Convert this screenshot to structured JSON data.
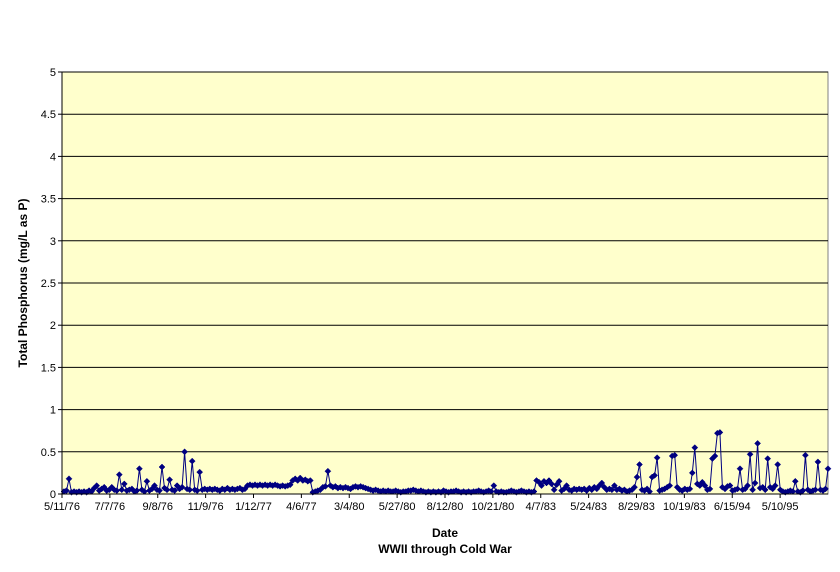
{
  "chart_data": {
    "type": "scatter",
    "line": true,
    "xlabel": "Date",
    "subtitle": "WWII through Cold War",
    "ylabel": "Total Phosphorus (mg/L as P)",
    "ylim": [
      0,
      5
    ],
    "yticks": [
      "0",
      "0.5",
      "1",
      "1.5",
      "2",
      "2.5",
      "3",
      "3.5",
      "4",
      "4.5",
      "5"
    ],
    "x_tick_labels": [
      "5/11/76",
      "7/7/76",
      "9/8/76",
      "11/9/76",
      "1/12/77",
      "4/6/77",
      "3/4/80",
      "5/27/80",
      "8/12/80",
      "10/21/80",
      "4/7/83",
      "5/24/83",
      "8/29/83",
      "10/19/83",
      "6/15/94",
      "5/10/95"
    ],
    "grid": "horizontal",
    "legend": "none",
    "plot_background": "#FFFFCC",
    "marker_color": "#000080",
    "series": [
      {
        "values": [
          0.03,
          0.04,
          0.18,
          0.02,
          0.03,
          0.02,
          0.03,
          0.02,
          0.03,
          0.02,
          0.04,
          0.03,
          0.07,
          0.1,
          0.04,
          0.06,
          0.08,
          0.04,
          0.05,
          0.08,
          0.05,
          0.04,
          0.23,
          0.05,
          0.12,
          0.04,
          0.05,
          0.06,
          0.03,
          0.04,
          0.3,
          0.05,
          0.03,
          0.15,
          0.04,
          0.06,
          0.1,
          0.05,
          0.04,
          0.32,
          0.07,
          0.05,
          0.17,
          0.05,
          0.04,
          0.1,
          0.06,
          0.08,
          0.5,
          0.06,
          0.05,
          0.39,
          0.05,
          0.04,
          0.26,
          0.05,
          0.06,
          0.05,
          0.06,
          0.05,
          0.06,
          0.05,
          0.04,
          0.06,
          0.05,
          0.07,
          0.05,
          0.06,
          0.05,
          0.06,
          0.07,
          0.05,
          0.06,
          0.1,
          0.11,
          0.1,
          0.11,
          0.1,
          0.11,
          0.1,
          0.11,
          0.1,
          0.11,
          0.1,
          0.11,
          0.1,
          0.09,
          0.1,
          0.09,
          0.1,
          0.11,
          0.16,
          0.18,
          0.16,
          0.19,
          0.16,
          0.17,
          0.15,
          0.16,
          0.02,
          0.03,
          0.04,
          0.05,
          0.08,
          0.09,
          0.27,
          0.1,
          0.08,
          0.09,
          0.07,
          0.08,
          0.07,
          0.08,
          0.07,
          0.06,
          0.08,
          0.09,
          0.08,
          0.09,
          0.08,
          0.07,
          0.06,
          0.05,
          0.04,
          0.05,
          0.04,
          0.03,
          0.04,
          0.03,
          0.04,
          0.03,
          0.03,
          0.04,
          0.03,
          0.02,
          0.03,
          0.03,
          0.04,
          0.04,
          0.05,
          0.04,
          0.03,
          0.04,
          0.03,
          0.02,
          0.03,
          0.02,
          0.03,
          0.02,
          0.03,
          0.02,
          0.04,
          0.03,
          0.02,
          0.03,
          0.03,
          0.04,
          0.03,
          0.02,
          0.03,
          0.02,
          0.03,
          0.02,
          0.03,
          0.03,
          0.04,
          0.03,
          0.02,
          0.03,
          0.04,
          0.03,
          0.1,
          0.03,
          0.02,
          0.03,
          0.02,
          0.02,
          0.03,
          0.04,
          0.03,
          0.02,
          0.03,
          0.04,
          0.03,
          0.02,
          0.03,
          0.02,
          0.03,
          0.16,
          0.14,
          0.1,
          0.15,
          0.13,
          0.16,
          0.12,
          0.05,
          0.11,
          0.15,
          0.04,
          0.06,
          0.1,
          0.05,
          0.04,
          0.06,
          0.05,
          0.06,
          0.05,
          0.06,
          0.04,
          0.07,
          0.05,
          0.08,
          0.06,
          0.1,
          0.13,
          0.08,
          0.05,
          0.06,
          0.05,
          0.1,
          0.05,
          0.06,
          0.04,
          0.05,
          0.03,
          0.04,
          0.05,
          0.08,
          0.2,
          0.35,
          0.05,
          0.04,
          0.06,
          0.03,
          0.2,
          0.22,
          0.43,
          0.04,
          0.05,
          0.06,
          0.08,
          0.1,
          0.45,
          0.46,
          0.08,
          0.05,
          0.04,
          0.06,
          0.05,
          0.06,
          0.25,
          0.55,
          0.12,
          0.1,
          0.14,
          0.1,
          0.05,
          0.06,
          0.42,
          0.45,
          0.72,
          0.73,
          0.08,
          0.06,
          0.09,
          0.1,
          0.04,
          0.05,
          0.06,
          0.3,
          0.05,
          0.06,
          0.1,
          0.47,
          0.05,
          0.13,
          0.6,
          0.07,
          0.08,
          0.05,
          0.42,
          0.08,
          0.06,
          0.1,
          0.35,
          0.05,
          0.03,
          0.02,
          0.03,
          0.04,
          0.03,
          0.15,
          0.03,
          0.02,
          0.04,
          0.46,
          0.05,
          0.03,
          0.04,
          0.05,
          0.38,
          0.05,
          0.04,
          0.06,
          0.3
        ]
      }
    ]
  }
}
